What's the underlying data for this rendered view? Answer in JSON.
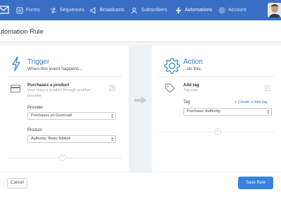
{
  "nav": {
    "items": [
      {
        "label": "Forms",
        "icon": "forms-icon"
      },
      {
        "label": "Sequences",
        "icon": "sequences-icon"
      },
      {
        "label": "Broadcasts",
        "icon": "broadcasts-icon"
      },
      {
        "label": "Subscribers",
        "icon": "subscribers-icon"
      },
      {
        "label": "Automations",
        "icon": "automations-icon"
      },
      {
        "label": "Account",
        "icon": "account-icon"
      }
    ],
    "active": "Automations"
  },
  "page": {
    "title": "utomation Rule"
  },
  "trigger": {
    "title": "Trigger",
    "subtitle": "When this event happens...",
    "step_title": "Purchases a product",
    "step_desc": "User buys a product through another provider",
    "provider_label": "Provider",
    "provider_value": "Purchases on Gumroad",
    "product_label": "Product",
    "product_value": "Authority: Basic Edition"
  },
  "action": {
    "title": "Action",
    "subtitle": "...do this.",
    "step_title": "Add tag",
    "step_desc": "Tag user",
    "tag_label": "Tag",
    "create_link": "+ Create a new tag",
    "tag_value": "Purchase: Authority"
  },
  "footer": {
    "cancel_label": "Cancel",
    "save_label": "Save Rule"
  },
  "colors": {
    "nav_bg": "#3a6fc6",
    "accent": "#2d7ad6",
    "save_button": "#3a80e0"
  }
}
